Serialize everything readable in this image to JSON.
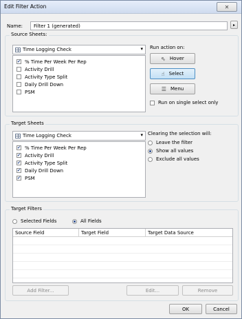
{
  "window": {
    "title": "Edit Filter Action",
    "close_glyph": "✕"
  },
  "name_field": {
    "label": "Name:",
    "value": "Filter 1 (generated)",
    "menu_glyph": "▸"
  },
  "source": {
    "section_label": "Source Sheets:",
    "dropdown_value": "Time Logging Check",
    "items": [
      {
        "label": "% Time Per Week Per Rep",
        "checked": true
      },
      {
        "label": "Activity Drill",
        "checked": false
      },
      {
        "label": "Activity Type Split",
        "checked": false
      },
      {
        "label": "Daily Drill Down",
        "checked": false
      },
      {
        "label": "PSM",
        "checked": false
      }
    ],
    "run_label": "Run action on:",
    "run_buttons": [
      {
        "label": "Hover",
        "icon": "cursor-icon",
        "selected": false
      },
      {
        "label": "Select",
        "icon": "hand-icon",
        "selected": true
      },
      {
        "label": "Menu",
        "icon": "menu-icon",
        "selected": false
      }
    ],
    "single_select": {
      "label": "Run on single select only",
      "checked": false
    }
  },
  "target": {
    "section_label": "Target Sheets",
    "dropdown_value": "Time Logging Check",
    "items": [
      {
        "label": "% Time Per Week Per Rep",
        "checked": true
      },
      {
        "label": "Activity Drill",
        "checked": true
      },
      {
        "label": "Activity Type Split",
        "checked": true
      },
      {
        "label": "Daily Drill Down",
        "checked": true
      },
      {
        "label": "PSM",
        "checked": true
      }
    ],
    "clearing_label": "Clearing the selection will:",
    "clearing_options": [
      {
        "label": "Leave the filter",
        "selected": false
      },
      {
        "label": "Show all values",
        "selected": true
      },
      {
        "label": "Exclude all values",
        "selected": false
      }
    ]
  },
  "target_filters": {
    "section_label": "Target Filters",
    "options": [
      {
        "label": "Selected Fields",
        "selected": false
      },
      {
        "label": "All Fields",
        "selected": true
      }
    ],
    "columns": [
      "Source Field",
      "Target Field",
      "Target Data Source"
    ],
    "buttons": {
      "add": "Add Filter...",
      "edit": "Edit...",
      "remove": "Remove"
    }
  },
  "footer": {
    "ok": "OK",
    "cancel": "Cancel"
  }
}
